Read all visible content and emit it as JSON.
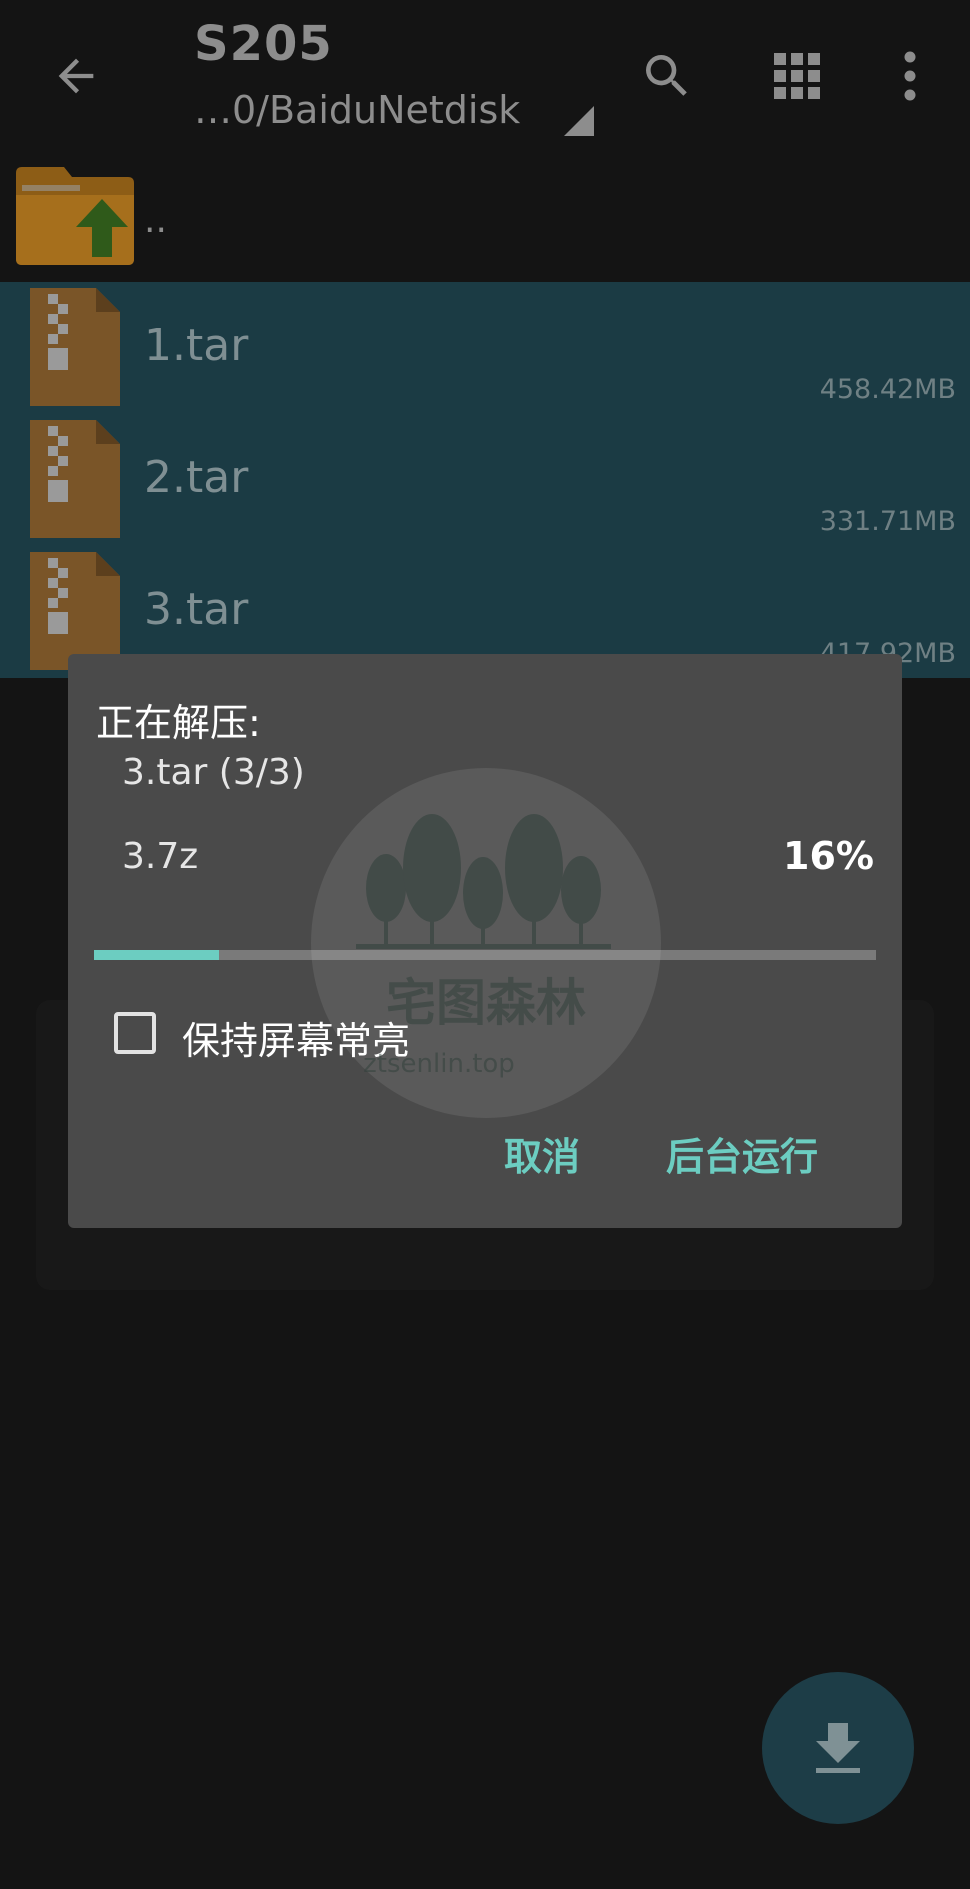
{
  "header": {
    "title": "S205",
    "path": "…0/BaiduNetdisk"
  },
  "list": {
    "parent_label": "..",
    "files": [
      {
        "name": "1.tar",
        "size": "458.42MB"
      },
      {
        "name": "2.tar",
        "size": "331.71MB"
      },
      {
        "name": "3.tar",
        "size": "417.92MB"
      }
    ]
  },
  "dialog": {
    "title": "正在解压:",
    "file_progress": "3.tar (3/3)",
    "current_entry": "3.7z",
    "percent_label": "16%",
    "progress": 0.16,
    "keep_screen_on_label": "保持屏幕常亮",
    "keep_screen_on_checked": false,
    "cancel_label": "取消",
    "background_label": "后台运行"
  },
  "watermark": {
    "brand": "宅图森林",
    "url": "ztsenlin.top"
  },
  "colors": {
    "accent": "#6ccdc1",
    "selection": "#1b3b44",
    "dialog_bg": "#4a4a4a",
    "folder": "#c7861f"
  },
  "icons": {
    "back": "arrow-left-icon",
    "search": "search-icon",
    "grid": "grid-view-icon",
    "more": "more-vert-icon",
    "parent": "folder-up-icon",
    "archive": "zip-file-icon",
    "fab": "download-icon"
  }
}
